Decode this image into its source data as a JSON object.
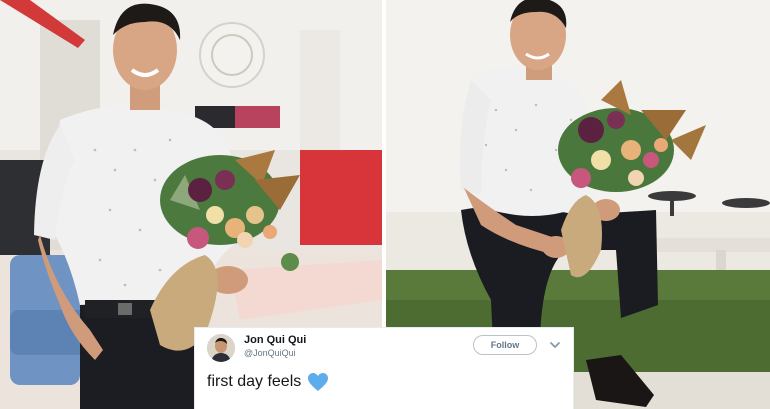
{
  "tweet": {
    "display_name": "Jon Qui Qui",
    "handle": "@JonQuiQui",
    "follow_label": "Follow",
    "text": "first day feels",
    "emoji_icon": "blue-heart-icon",
    "follow_border_color": "#b9c3cb",
    "heart_color": "#5dadec"
  },
  "photos": [
    {
      "name": "photo-left",
      "description_icon": "man-holding-bouquet-office"
    },
    {
      "name": "photo-right",
      "description_icon": "man-sitting-with-bouquet"
    }
  ]
}
